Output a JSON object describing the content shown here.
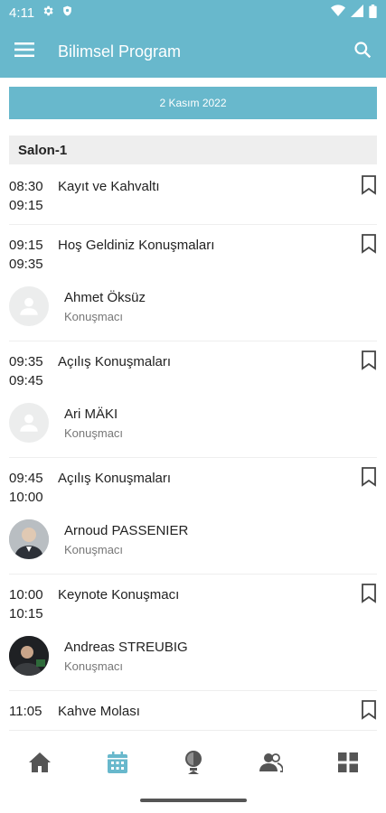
{
  "status": {
    "time": "4:11"
  },
  "appbar": {
    "title": "Bilimsel Program"
  },
  "date": "2 Kasım 2022",
  "salon": "Salon-1",
  "sessions": [
    {
      "start": "08:30",
      "end": "09:15",
      "title": "Kayıt ve Kahvaltı"
    },
    {
      "start": "09:15",
      "end": "09:35",
      "title": "Hoş Geldiniz Konuşmaları",
      "speaker": {
        "name": "Ahmet Öksüz",
        "role": "Konuşmacı"
      }
    },
    {
      "start": "09:35",
      "end": "09:45",
      "title": "Açılış Konuşmaları",
      "speaker": {
        "name": "Ari MÄKI",
        "role": "Konuşmacı"
      }
    },
    {
      "start": "09:45",
      "end": "10:00",
      "title": "Açılış Konuşmaları",
      "speaker": {
        "name": "Arnoud PASSENIER",
        "role": "Konuşmacı"
      }
    },
    {
      "start": "10:00",
      "end": "10:15",
      "title": "Keynote Konuşmacı",
      "speaker": {
        "name": "Andreas STREUBIG",
        "role": "Konuşmacı"
      }
    },
    {
      "start": "11:05",
      "end": "",
      "title": "Kahve Molası"
    }
  ],
  "nav": {
    "active": "calendar",
    "accent": "#68b8cc",
    "inactive": "#555555"
  }
}
